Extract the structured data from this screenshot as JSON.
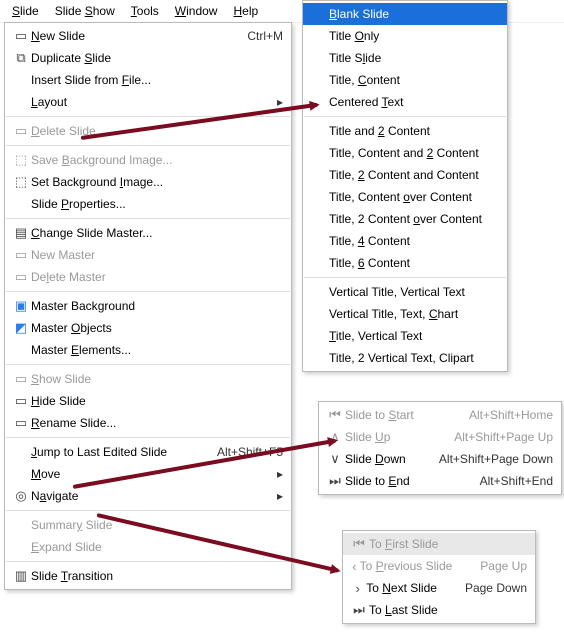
{
  "menubar": {
    "items": [
      {
        "label": "Slide",
        "ul": 0
      },
      {
        "label": "Slide Show",
        "ul": 6
      },
      {
        "label": "Tools",
        "ul": 0
      },
      {
        "label": "Window",
        "ul": 0
      },
      {
        "label": "Help",
        "ul": 0
      }
    ]
  },
  "slide_menu": {
    "items": [
      {
        "icon": "new-slide-icon",
        "label": "New Slide",
        "ul": 0,
        "shortcut": "Ctrl+M",
        "interact": true
      },
      {
        "icon": "dup-slide-icon",
        "label": "Duplicate Slide",
        "ul": 10,
        "interact": true
      },
      {
        "icon": "",
        "label": "Insert Slide from File...",
        "ul": 18,
        "interact": true
      },
      {
        "icon": "",
        "label": "Layout",
        "ul": 0,
        "submenu": true,
        "interact": true
      },
      {
        "type": "sep"
      },
      {
        "icon": "delete-slide-icon",
        "label": "Delete Slide",
        "ul": 0,
        "disabled": true,
        "interact": true
      },
      {
        "type": "sep"
      },
      {
        "icon": "save-bg-icon",
        "label": "Save Background Image...",
        "ul": 5,
        "disabled": true,
        "interact": true
      },
      {
        "icon": "set-bg-icon",
        "label": "Set Background Image...",
        "ul": 15,
        "interact": true
      },
      {
        "icon": "",
        "label": "Slide Properties...",
        "ul": 6,
        "interact": true
      },
      {
        "type": "sep"
      },
      {
        "icon": "change-master-icon",
        "label": "Change Slide Master...",
        "ul": 0,
        "interact": true
      },
      {
        "icon": "new-master-icon",
        "label": "New Master",
        "ul": null,
        "disabled": true,
        "interact": true
      },
      {
        "icon": "delete-master-icon",
        "label": "Delete Master",
        "ul": 2,
        "disabled": true,
        "interact": true
      },
      {
        "type": "sep"
      },
      {
        "icon": "master-bg-icon",
        "label": "Master Background",
        "ul": 11,
        "selected": true,
        "interact": true
      },
      {
        "icon": "master-obj-icon",
        "label": "Master Objects",
        "ul": 7,
        "selected": true,
        "interact": true
      },
      {
        "icon": "",
        "label": "Master Elements...",
        "ul": 7,
        "interact": true
      },
      {
        "type": "sep"
      },
      {
        "icon": "show-slide-icon",
        "label": "Show Slide",
        "ul": 0,
        "disabled": true,
        "interact": true
      },
      {
        "icon": "hide-slide-icon",
        "label": "Hide Slide",
        "ul": 0,
        "interact": true
      },
      {
        "icon": "rename-icon",
        "label": "Rename Slide...",
        "ul": 0,
        "interact": true
      },
      {
        "type": "sep"
      },
      {
        "icon": "",
        "label": "Jump to Last Edited Slide",
        "ul": 0,
        "shortcut": "Alt+Shift+F5",
        "interact": true
      },
      {
        "icon": "",
        "label": "Move",
        "ul": 0,
        "submenu": true,
        "interact": true
      },
      {
        "icon": "navigate-icon",
        "label": "Navigate",
        "ul": 1,
        "submenu": true,
        "interact": true
      },
      {
        "type": "sep"
      },
      {
        "icon": "",
        "label": "Summary Slide",
        "ul": 6,
        "disabled": true,
        "interact": true
      },
      {
        "icon": "",
        "label": "Expand Slide",
        "ul": 0,
        "disabled": true,
        "interact": true
      },
      {
        "type": "sep"
      },
      {
        "icon": "transition-icon",
        "label": "Slide Transition",
        "ul": 6,
        "interact": true
      }
    ]
  },
  "layout_submenu": {
    "items": [
      {
        "label": "Blank Slide",
        "ul": 0,
        "highlight": true
      },
      {
        "label": "Title Only",
        "ul": 6
      },
      {
        "label": "Title Slide",
        "ul": 7
      },
      {
        "label": "Title, Content",
        "ul": 7
      },
      {
        "label": "Centered Text",
        "ul": 9
      },
      {
        "type": "sep"
      },
      {
        "label": "Title and 2 Content",
        "ul": 10
      },
      {
        "label": "Title, Content and 2 Content",
        "ul": 19
      },
      {
        "label": "Title, 2 Content and Content",
        "ul": 7
      },
      {
        "label": "Title, Content over Content",
        "ul": 15
      },
      {
        "label": "Title, 2 Content over Content",
        "ul": 17
      },
      {
        "label": "Title, 4 Content",
        "ul": 7
      },
      {
        "label": "Title, 6 Content",
        "ul": 7
      },
      {
        "type": "sep"
      },
      {
        "label": "Vertical Title, Vertical Text"
      },
      {
        "label": "Vertical Title, Text, Chart",
        "ul": 22
      },
      {
        "label": "Title, Vertical Text",
        "ul": 0
      },
      {
        "label": "Title, 2 Vertical Text, Clipart"
      }
    ]
  },
  "move_submenu": {
    "items": [
      {
        "icon": "first-icon",
        "label": "Slide to Start",
        "ul": 9,
        "shortcut": "Alt+Shift+Home",
        "disabled": true
      },
      {
        "icon": "up-icon",
        "label": "Slide Up",
        "ul": 6,
        "shortcut": "Alt+Shift+Page Up",
        "disabled": true
      },
      {
        "icon": "down-icon",
        "label": "Slide Down",
        "ul": 6,
        "shortcut": "Alt+Shift+Page Down"
      },
      {
        "icon": "last-icon",
        "label": "Slide to End",
        "ul": 9,
        "shortcut": "Alt+Shift+End"
      }
    ]
  },
  "navigate_submenu": {
    "items": [
      {
        "icon": "first-icon",
        "label": "To First Slide",
        "ul": 3,
        "disabled": true,
        "hoverlight": true
      },
      {
        "icon": "prev-icon",
        "label": "To Previous Slide",
        "ul": 3,
        "shortcut": "Page Up",
        "disabled": true
      },
      {
        "icon": "next-icon",
        "label": "To Next Slide",
        "ul": 3,
        "shortcut": "Page Down"
      },
      {
        "icon": "last-icon",
        "label": "To Last Slide",
        "ul": 3
      }
    ]
  }
}
